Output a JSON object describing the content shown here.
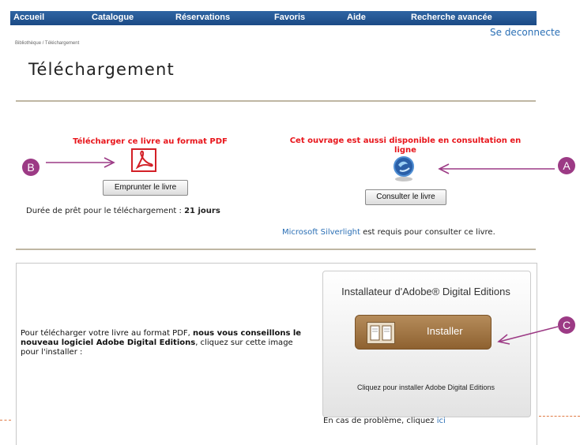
{
  "nav": {
    "items": [
      "Accueil",
      "Catalogue",
      "Réservations",
      "Favoris",
      "Aide",
      "Recherche avancée"
    ],
    "logout": "Se deconnecte"
  },
  "breadcrumb": "Bibliothèque / Téléchargement",
  "page_title": "Téléchargement",
  "pdf_section": {
    "heading": "Télécharger ce livre au format PDF",
    "button": "Emprunter le livre",
    "loan_label": "Durée de prêt pour le téléchargement :",
    "loan_value": "21 jours"
  },
  "online_section": {
    "heading": "Cet ouvrage est aussi disponible en consultation en ligne",
    "button": "Consulter le livre",
    "silverlight_link": "Microsoft Silverlight",
    "silverlight_note": "est requis pour consulter ce livre."
  },
  "adobe": {
    "intro_start": "Pour télécharger votre livre au format PDF, ",
    "intro_bold": "nous vous conseillons le nouveau logiciel Adobe Digital Editions",
    "intro_end": ", cliquez sur cette image pour l'installer :",
    "panel_title": "Installateur d'Adobe® Digital Editions",
    "install_button": "Installer",
    "caption": "Cliquez pour installer Adobe Digital Editions",
    "problem_text": "En cas de problème, cliquez",
    "problem_link": "ici"
  },
  "annotations": {
    "a": "A",
    "b": "B",
    "c": "C"
  },
  "colors": {
    "nav": "#1b4a85",
    "red": "#e8151b",
    "marker": "#9c3a85",
    "link": "#2a6fb5"
  }
}
